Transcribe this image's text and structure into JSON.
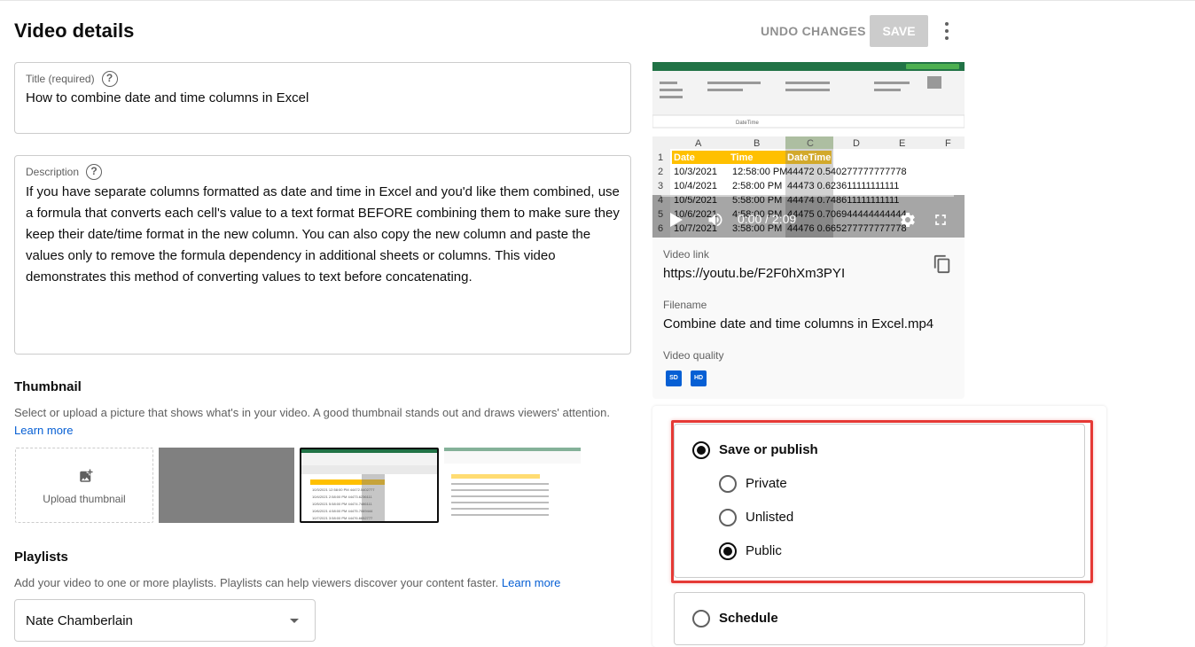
{
  "header": {
    "title": "Video details",
    "undo_label": "UNDO CHANGES",
    "save_label": "SAVE"
  },
  "title_field": {
    "label": "Title (required)",
    "value": "How to combine date and time columns in Excel"
  },
  "description_field": {
    "label": "Description",
    "value": "If you have separate columns formatted as date and time in Excel and you'd like them combined, use a formula that converts each cell's value to a text format BEFORE combining them to make sure they keep their date/time format in the new column. You can also copy the new column and paste the values only to remove the formula dependency in additional sheets or columns. This video demonstrates this method of converting values to text before concatenating."
  },
  "thumbnail": {
    "heading": "Thumbnail",
    "subtext": "Select or upload a picture that shows what's in your video. A good thumbnail stands out and draws viewers' attention.",
    "learn_more": "Learn more",
    "upload_label": "Upload thumbnail"
  },
  "playlists": {
    "heading": "Playlists",
    "subtext": "Add your video to one or more playlists. Playlists can help viewers discover your content faster.",
    "learn_more": "Learn more",
    "selected": "Nate Chamberlain"
  },
  "video": {
    "time": "0:00 / 2:09",
    "spreadsheet": {
      "columns": [
        "A",
        "B",
        "C",
        "D",
        "E",
        "F"
      ],
      "headers": [
        "Date",
        "Time",
        "DateTime"
      ],
      "rows": [
        [
          "1",
          "",
          "",
          ""
        ],
        [
          "2",
          "10/3/2021",
          "12:58:00 PM",
          "44472 0.540277777777778"
        ],
        [
          "3",
          "10/4/2021",
          "2:58:00 PM",
          "44473 0.623611111111111"
        ],
        [
          "4",
          "10/5/2021",
          "5:58:00 PM",
          "44474 0.748611111111111"
        ],
        [
          "5",
          "10/6/2021",
          "4:58:00 PM",
          "44475 0.706944444444444"
        ],
        [
          "6",
          "10/7/2021",
          "3:58:00 PM",
          "44476 0.665277777777778"
        ]
      ]
    }
  },
  "details": {
    "video_link_label": "Video link",
    "video_link": "https://youtu.be/F2F0hXm3PYI",
    "filename_label": "Filename",
    "filename": "Combine date and time columns in Excel.mp4",
    "quality_label": "Video quality",
    "quality_badges": [
      "SD",
      "HD"
    ]
  },
  "visibility": {
    "main_option": "Save or publish",
    "options": [
      "Private",
      "Unlisted",
      "Public"
    ],
    "selected": "Public",
    "schedule_option": "Schedule"
  },
  "colors": {
    "accent_link": "#065fd4",
    "highlight_border": "#e53935",
    "excel_header": "#ffc000",
    "excel_green": "#217346"
  }
}
